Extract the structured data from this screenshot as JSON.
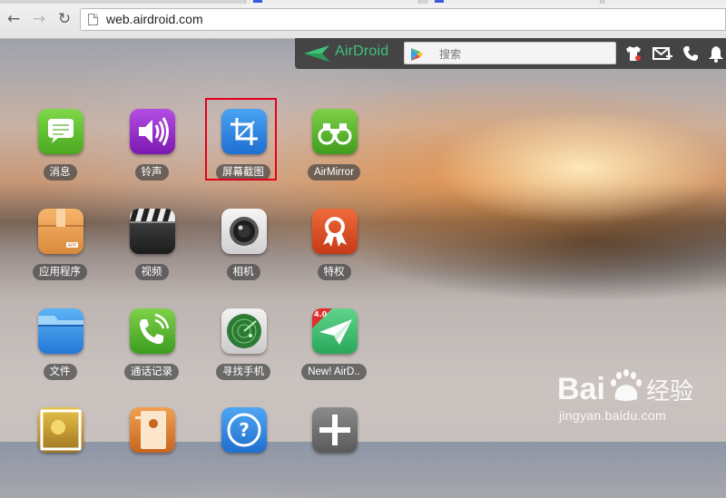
{
  "browser": {
    "url": "web.airdroid.com",
    "icons": [
      "back-icon",
      "forward-icon",
      "reload-icon",
      "page-icon"
    ]
  },
  "airdroid": {
    "logo_text": "AirDroid",
    "search_placeholder": "搜索",
    "toolbar_icons": [
      "tshirt-icon",
      "message-add-icon",
      "phone-icon",
      "bell-icon"
    ],
    "accent": "#3fc27a"
  },
  "apps": [
    {
      "label": "消息",
      "icon": "messages-icon",
      "color": "#5bbd2c"
    },
    {
      "label": "铃声",
      "icon": "ringtone-icon",
      "color": "#8f2bc4"
    },
    {
      "label": "屏幕截图",
      "icon": "screenshot-crop-icon",
      "color": "#2a7fe0"
    },
    {
      "label": "AirMirror",
      "icon": "binoculars-icon",
      "color": "#59b62f"
    },
    {
      "label": "应用程序",
      "icon": "app-box-icon",
      "color": "#e99a4d"
    },
    {
      "label": "视频",
      "icon": "clapperboard-icon",
      "color": "#2e2e2e"
    },
    {
      "label": "相机",
      "icon": "camera-lens-icon",
      "color": "#e6e6e6"
    },
    {
      "label": "特权",
      "icon": "privilege-badge-icon",
      "color": "#d84a24"
    },
    {
      "label": "文件",
      "icon": "folder-icon",
      "color": "#2f8fe6"
    },
    {
      "label": "通话记录",
      "icon": "call-log-icon",
      "color": "#52b233"
    },
    {
      "label": "寻找手机",
      "icon": "radar-icon",
      "color": "#2f7a3a"
    },
    {
      "label": "New! AirD..",
      "icon": "paper-plane-icon",
      "color": "#3cc06b",
      "badge": "4.0"
    },
    {
      "icon": "photo-icon",
      "color": "#c9a236"
    },
    {
      "icon": "contacts-book-icon",
      "color": "#d2772c"
    },
    {
      "icon": "help-icon",
      "color": "#2d8ae0"
    },
    {
      "icon": "add-app-icon",
      "color": "#6d6d6d"
    }
  ],
  "watermark": {
    "brand": "Bai经验",
    "url": "jingyan.baidu.com"
  }
}
